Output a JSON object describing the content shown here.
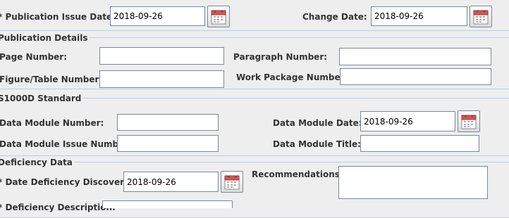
{
  "top": {
    "publication_issue_date_label": "* Publication Issue Date:",
    "publication_issue_date_value": "2018-09-26",
    "change_date_label": "Change Date:",
    "change_date_value": "2018-09-26"
  },
  "publication_details": {
    "title": "Publication Details",
    "page_number_label": "Page Number:",
    "page_number_value": "",
    "paragraph_number_label": "Paragraph Number:",
    "paragraph_number_value": "",
    "figure_table_number_label": "Figure/Table Number:",
    "figure_table_number_value": "",
    "work_package_number_label": "Work Package Number:",
    "work_package_number_value": ""
  },
  "s1000d": {
    "title": "S1000D Standard",
    "data_module_number_label": "Data Module Number:",
    "data_module_number_value": "",
    "data_module_date_label": "Data Module Date:",
    "data_module_date_value": "2018-09-26",
    "data_module_issue_number_label": "Data Module Issue Number:",
    "data_module_issue_number_value": "",
    "data_module_title_label": "Data Module Title:",
    "data_module_title_value": ""
  },
  "deficiency": {
    "title": "Deficiency Data",
    "date_discovered_label": "* Date Deficiency Discovered:",
    "date_discovered_value": "2018-09-26",
    "recommendations_label": "Recommendations:",
    "recommendations_value": "",
    "description_label": "* Deficiency Description:",
    "description_value": ""
  },
  "icons": {
    "calendar": "calendar-icon"
  },
  "colors": {
    "background": "#eeeeee",
    "border": "#b8cfe5",
    "calendar_red": "#d9534f"
  }
}
